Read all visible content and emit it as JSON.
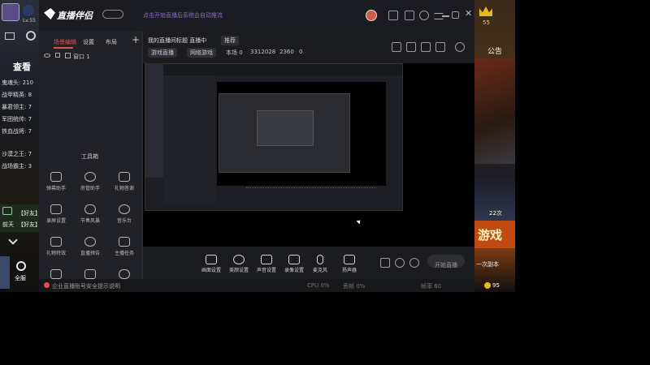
{
  "left_game": {
    "level": "Lv.55",
    "header_title": "查看",
    "rows": [
      "鬼魂头: 210",
      "战甲精英: 8",
      "暴君领主: 7",
      "军团统帅: 7",
      "铁血战将: 7",
      "沙漠之王: 7",
      "战场霸主: 3"
    ],
    "chat_lines": [
      "前天",
      "【好友】",
      "【好友】"
    ],
    "settings_label": "全服"
  },
  "right_game": {
    "top_count": "55",
    "notice": "公告",
    "banner_text": "游戏",
    "online_text": "22次",
    "friend_text": "一次副本",
    "coin": "95"
  },
  "app": {
    "logo": "直播伴侣",
    "version": "",
    "title_notice": "点击开始直播后系统会自动推流",
    "user_status": "",
    "sidebar_tabs": [
      "场景编辑",
      "设置",
      "布局"
    ],
    "scene_item": "窗口 1",
    "toolbox_title": "工具箱",
    "tools": [
      {
        "label": "弹幕助手",
        "icon": "chat-icon"
      },
      {
        "label": "房管助手",
        "icon": "person-icon"
      },
      {
        "label": "礼物答谢",
        "icon": "gift-icon"
      },
      {
        "label": "录屏设置",
        "icon": "shield-icon"
      },
      {
        "label": "节奏风暴",
        "icon": "cloud-icon"
      },
      {
        "label": "音乐台",
        "icon": "music-icon"
      },
      {
        "label": "礼物特效",
        "icon": "heart-icon"
      },
      {
        "label": "直播预告",
        "icon": "clock-icon"
      },
      {
        "label": "主播任务",
        "icon": "task-icon"
      },
      {
        "label": "",
        "icon": "link-icon"
      },
      {
        "label": "",
        "icon": "share-icon"
      },
      {
        "label": "",
        "icon": "game-icon"
      }
    ],
    "stream_title": "我的直播间标题 直播中",
    "stream_tag": "推荐",
    "category": "游戏直播",
    "category2": "网络游戏",
    "stat1": "本场 0",
    "stat2": "3312028",
    "stat3": "2360",
    "stat4": "0",
    "controls": [
      {
        "label": "画面设置",
        "icon": "screen-icon"
      },
      {
        "label": "美颜设置",
        "icon": "camera-icon"
      },
      {
        "label": "声音设置",
        "icon": "voice-icon"
      },
      {
        "label": "录像设置",
        "icon": "play-icon"
      },
      {
        "label": "麦克风",
        "icon": "mic-icon"
      },
      {
        "label": "扬声器",
        "icon": "speaker-icon"
      }
    ],
    "start_button": "开始直播",
    "footer_text": "企业直播账号安全提示说明",
    "footer_right1": "CPU 0%",
    "footer_right2": "丢帧 0%",
    "footer_right3": "帧率 60"
  }
}
